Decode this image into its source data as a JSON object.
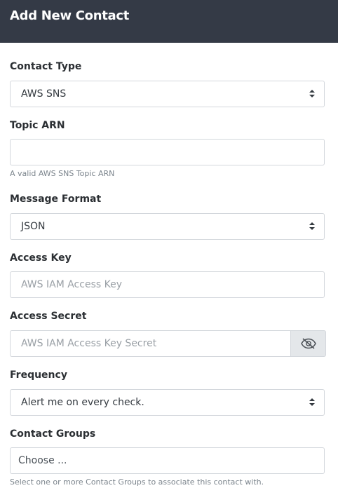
{
  "header": {
    "title": "Add New Contact"
  },
  "contact_type": {
    "label": "Contact Type",
    "value": "AWS SNS"
  },
  "topic_arn": {
    "label": "Topic ARN",
    "value": "",
    "help": "A valid AWS SNS Topic ARN"
  },
  "message_format": {
    "label": "Message Format",
    "value": "JSON"
  },
  "access_key": {
    "label": "Access Key",
    "placeholder": "AWS IAM Access Key"
  },
  "access_secret": {
    "label": "Access Secret",
    "placeholder": "AWS IAM Access Key Secret",
    "toggle_icon": "eye-slash-icon"
  },
  "frequency": {
    "label": "Frequency",
    "value": "Alert me on every check."
  },
  "contact_groups": {
    "label": "Contact Groups",
    "placeholder": "Choose ...",
    "help": "Select one or more Contact Groups to associate this contact with."
  },
  "colors": {
    "header_bg": "#343a46",
    "border": "#d3d7dc",
    "addon_bg": "#e4e7ea"
  }
}
